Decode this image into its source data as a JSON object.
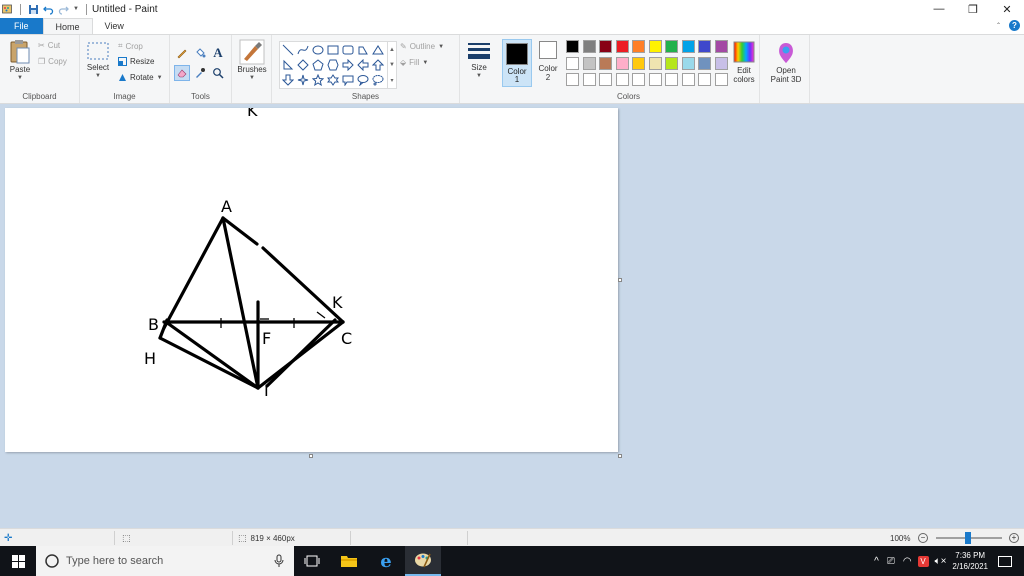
{
  "window": {
    "title": "Untitled - Paint",
    "controls": {
      "minimize": "—",
      "restore": "❐",
      "close": "✕"
    }
  },
  "tabs": [
    {
      "label": "File"
    },
    {
      "label": "Home"
    },
    {
      "label": "View"
    }
  ],
  "ribbon": {
    "clipboard": {
      "label": "Clipboard",
      "paste": "Paste",
      "cut": "Cut",
      "copy": "Copy"
    },
    "image": {
      "label": "Image",
      "select": "Select",
      "crop": "Crop",
      "resize": "Resize",
      "rotate": "Rotate"
    },
    "tools": {
      "label": "Tools"
    },
    "brushes": {
      "label": "Brushes"
    },
    "shapes": {
      "label": "Shapes",
      "outline": "Outline",
      "fill": "Fill"
    },
    "size": {
      "label": "Size"
    },
    "colors": {
      "label": "Colors",
      "color1_label": "Color",
      "color1_num": "1",
      "color2_label": "Color",
      "color2_num": "2",
      "edit_label": "Edit",
      "edit_label2": "colors",
      "open3d_label": "Open",
      "open3d_label2": "Paint 3D",
      "color1_value": "#000000",
      "color2_value": "#ffffff",
      "palette_row1": [
        "#000000",
        "#7f7f7f",
        "#880015",
        "#ed1c24",
        "#ff7f27",
        "#fff200",
        "#22b14c",
        "#00a2e8",
        "#3f48cc",
        "#a349a4"
      ],
      "palette_row2": [
        "#ffffff",
        "#c3c3c3",
        "#b97a57",
        "#ffaec9",
        "#ffc90e",
        "#efe4b0",
        "#b5e61d",
        "#99d9ea",
        "#7092be",
        "#c8bfe7"
      ],
      "palette_row3": [
        "#ffffff",
        "#ffffff",
        "#ffffff",
        "#ffffff",
        "#ffffff",
        "#ffffff",
        "#ffffff",
        "#ffffff",
        "#ffffff",
        "#ffffff"
      ]
    }
  },
  "drawing": {
    "labels": {
      "a": "A",
      "b": "B",
      "c": "C",
      "k": "K",
      "h": "H",
      "f": "F",
      "i": "I",
      "top": "K"
    }
  },
  "statusbar": {
    "dimensions": "819 × 460px",
    "zoom": "100%",
    "zoom_out": "−",
    "zoom_in": "+"
  },
  "taskbar": {
    "search_placeholder": "Type here to search",
    "time": "7:36 PM",
    "date": "2/16/2021"
  }
}
